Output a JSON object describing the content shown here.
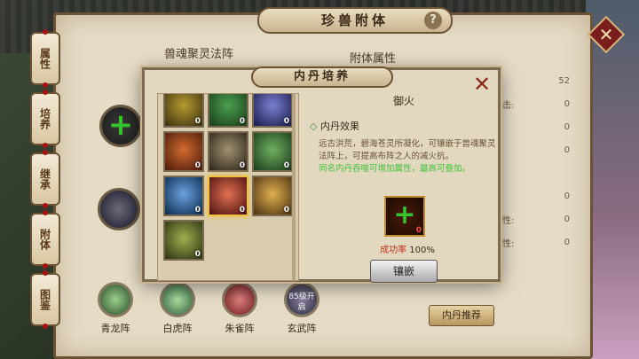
{
  "panel": {
    "title": "珍兽附体",
    "help": "?"
  },
  "side_tabs": [
    "属性",
    "培养",
    "继承",
    "附体",
    "图鉴"
  ],
  "formation": {
    "title": "兽魂聚灵法阵"
  },
  "attributes": {
    "title": "附体属性",
    "rows": [
      {
        "label": "",
        "value": "52"
      },
      {
        "label": "击:",
        "value": "0"
      },
      {
        "label": "",
        "value": "0"
      },
      {
        "label": "",
        "value": "0"
      },
      {
        "label": "",
        "value": "0"
      },
      {
        "label": "性:",
        "value": "0"
      },
      {
        "label": "性:",
        "value": "0"
      }
    ]
  },
  "beasts": [
    {
      "name": "青龙阵",
      "color": "#4a8a4a"
    },
    {
      "name": "白虎阵",
      "color": "#4aa060"
    },
    {
      "name": "朱雀阵",
      "color": "#b04040"
    },
    {
      "name": "玄武阵",
      "color": "#504a6a",
      "lock": "85级开启"
    }
  ],
  "recommend_label": "内丹推荐",
  "modal": {
    "title": "内丹培养",
    "close": "✕",
    "gems": [
      {
        "c1": "#b59a30",
        "c2": "#3a3010",
        "count": "0"
      },
      {
        "c1": "#4aa050",
        "c2": "#1a3a1a",
        "count": "0"
      },
      {
        "c1": "#7a80d0",
        "c2": "#1a1a4a",
        "count": "0"
      },
      {
        "c1": "#d06a30",
        "c2": "#4a1a0a",
        "count": "0"
      },
      {
        "c1": "#a09070",
        "c2": "#2a2418",
        "count": "0"
      },
      {
        "c1": "#70b060",
        "c2": "#1a3a1a",
        "count": "0"
      },
      {
        "c1": "#6aa0e0",
        "c2": "#0a2a4a",
        "count": "0"
      },
      {
        "c1": "#e07050",
        "c2": "#4a1010",
        "count": "0",
        "selected": true
      },
      {
        "c1": "#e0b050",
        "c2": "#4a3010",
        "count": "0"
      },
      {
        "c1": "#a0b050",
        "c2": "#2a3010",
        "count": "0"
      }
    ],
    "detail": {
      "name": "御火",
      "effect_title": "内丹效果",
      "effect_text": "远古洪荒，碧海苍灵所凝化，可镶嵌于兽魂聚灵法阵上，可提高布阵之人的减火抗。",
      "effect_green": "同名内丹吞噬可增加属性，最高可叠加。",
      "embed_count": "0",
      "success_label": "成功率",
      "success_value": "100%",
      "embed_button": "镶嵌"
    }
  }
}
